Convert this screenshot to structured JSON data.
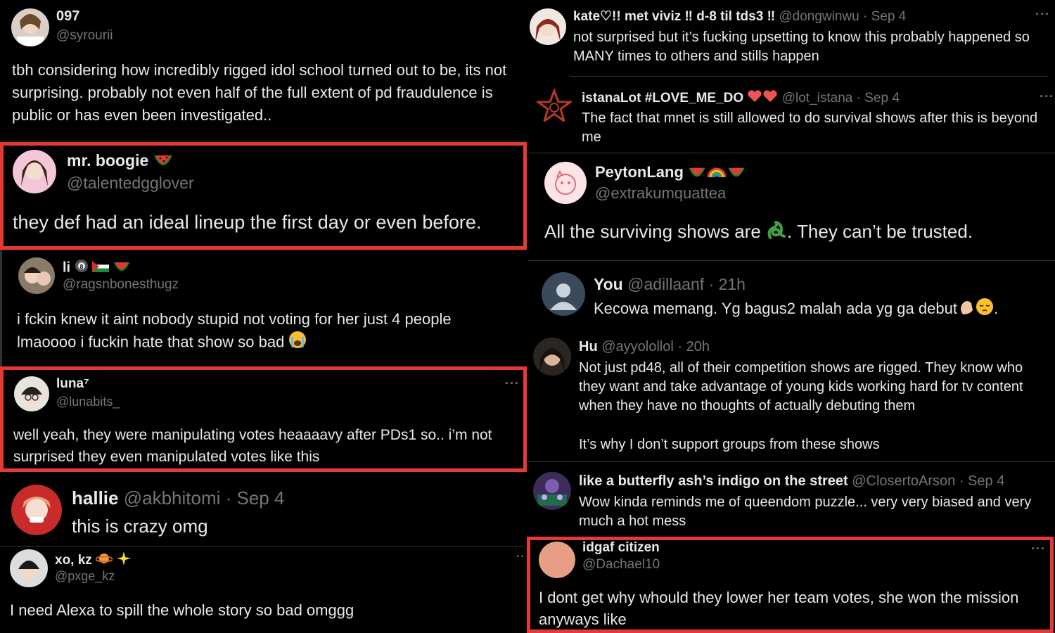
{
  "left": [
    {
      "name": "097",
      "handle": "@syrourii",
      "text": "tbh considering how incredibly rigged idol school turned out to be, its not surprising.  probably not even half of the full extent of pd fraudulence is public or has even been investigated.."
    },
    {
      "name": "mr. boogie",
      "handle": "@talentedgglover",
      "text": "they def had an ideal lineup the first day or even before."
    },
    {
      "name": "li",
      "handle": "@ragsnbonesthugz",
      "text": "i fckin knew it aint nobody stupid not voting for her just 4 people lmaoooo i fuckin hate that show so bad"
    },
    {
      "name": "luna⁷",
      "handle": "@lunabits_",
      "text": "well yeah, they were manipulating votes heaaaavy after PDs1 so.. i’m not surprised they even manipulated votes like this"
    },
    {
      "name": "hallie",
      "handle": "@akbhitomi",
      "time": "· Sep 4",
      "text": "this is crazy omg"
    },
    {
      "name": "xo, kz",
      "handle": "@pxge_kz",
      "text": "I need Alexa to spill the whole story so bad omggg"
    }
  ],
  "right": [
    {
      "name": "kate♡!!  met viviz ‼ d-8 til tds3 ‼",
      "handle": "@dongwinwu",
      "time": "· Sep 4",
      "text": "not surprised but it’s fucking upsetting to know this probably happened so MANY times to others and stills happen"
    },
    {
      "name": "istanaLot #LOVE_ME_DO",
      "handle": "@lot_istana",
      "time": "· Sep 4",
      "text": "The fact that mnet is still allowed to do survival shows after this is beyond me"
    },
    {
      "name": "PeytonLang",
      "handle": "@extrakumquattea",
      "text_a": "All the surviving shows are",
      "text_b": ". They can’t be trusted."
    },
    {
      "name": "You",
      "handle": "@adillaanf",
      "time": "· 21h",
      "text": "Kecowa memang. Yg bagus2 malah ada yg ga debut"
    },
    {
      "name": "Hu",
      "handle": "@ayyolollol",
      "time": "· 20h",
      "text": "Not just pd48, all of their competition shows are rigged. They know who they want and take advantage of young kids working hard for tv content when they have no thoughts of actually debuting them",
      "text2": "It’s why I don’t support groups from these shows"
    },
    {
      "name": "like a butterfly ash’s indigo on the street",
      "handle": "@ClosertoArson",
      "time": "· Sep 4",
      "text": "Wow kinda reminds me of queendom puzzle... very very biased and very much a hot mess"
    },
    {
      "name": "idgaf citizen",
      "handle": "@Dachael10",
      "text": "I dont get why whould they lower her team votes, she won the mission anyways like"
    }
  ],
  "ui": {
    "more": "···",
    "period": "."
  },
  "colors": {
    "highlight": "#e53935",
    "secondary": "#71767b",
    "text": "#e7e9ea",
    "divider": "#2f3336"
  },
  "icons": [
    "more-options-icon",
    "watermelon-emoji",
    "rainbow-emoji",
    "palestine-flag-emoji",
    "pool-8-ball-emoji",
    "crying-emoji",
    "ringed-planet-emoji",
    "sparkles-emoji",
    "snake-emoji",
    "pinched-hand-emoji",
    "pensive-emoji",
    "heart-emoji",
    "star-emoji"
  ]
}
